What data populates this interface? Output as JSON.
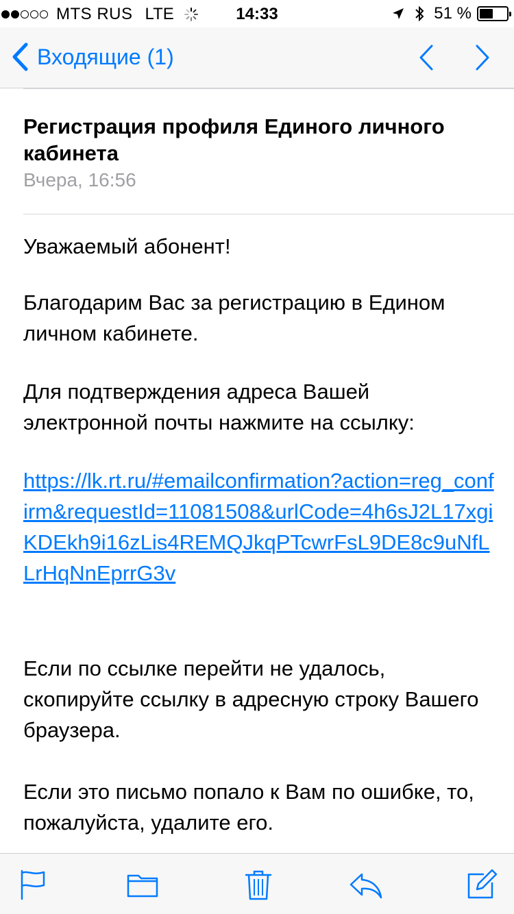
{
  "status_bar": {
    "carrier": "MTS RUS",
    "network": "LTE",
    "time": "14:33",
    "battery_percent": "51 %",
    "battery_level": 0.51,
    "signal_bars": 2,
    "signal_total": 5
  },
  "nav": {
    "back_label": "Входящие (1)",
    "accent_color": "#007aff"
  },
  "email": {
    "subject": "Регистрация профиля Единого личного кабинета",
    "date": "Вчера, 16:56",
    "greeting": "Уважаемый абонент!",
    "paragraph_thanks": "Благодарим Вас за регистрацию в Едином личном кабинете.",
    "paragraph_confirm": "Для подтверждения адреса Вашей электронной почты нажмите на ссылку:",
    "confirmation_link": "https://lk.rt.ru/#emailconfirmation?action=reg_confirm&requestId=11081508&urlCode=4h6sJ2L17xgiKDEkh9i16zLis4REMQJkqPTcwrFsL9DE8c9uNfLLrHqNnEprrG3v",
    "paragraph_fallback": "Если по ссылке перейти не удалось, скопируйте ссылку в адресную строку Вашего браузера.",
    "paragraph_mistake": "Если это письмо попало к Вам по ошибке, то, пожалуйста, удалите его."
  },
  "toolbar": {
    "icons": [
      "flag-icon",
      "folder-icon",
      "trash-icon",
      "reply-icon",
      "compose-icon"
    ]
  }
}
